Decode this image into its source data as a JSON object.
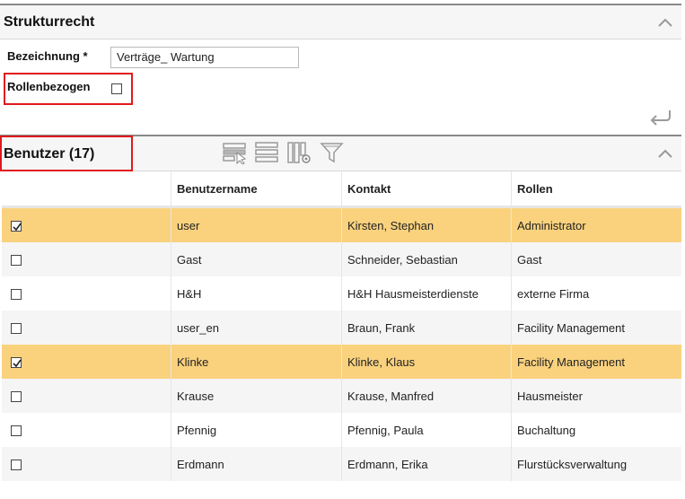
{
  "section1": {
    "title": "Strukturrecht"
  },
  "form": {
    "bezeichnung_label": "Bezeichnung *",
    "bezeichnung_value": "Verträge_ Wartung",
    "rollenbezogen_label": "Rollenbezogen",
    "rollenbezogen_checked": false
  },
  "section2": {
    "title": "Benutzer (17)"
  },
  "toolbar_icons": [
    "select-row-icon",
    "list-view-icon",
    "column-settings-icon",
    "filter-icon"
  ],
  "colors": {
    "selected_row": "#fad27e",
    "highlight_border": "#e0191d"
  },
  "table": {
    "headers": [
      "",
      "Benutzername",
      "Kontakt",
      "Rollen"
    ],
    "rows": [
      {
        "checked": true,
        "username": "user",
        "contact": "Kirsten, Stephan",
        "role": "Administrator"
      },
      {
        "checked": false,
        "username": "Gast",
        "contact": "Schneider, Sebastian",
        "role": "Gast"
      },
      {
        "checked": false,
        "username": "H&H",
        "contact": "H&H Hausmeisterdienste",
        "role": "externe Firma"
      },
      {
        "checked": false,
        "username": "user_en",
        "contact": "Braun, Frank",
        "role": "Facility Management"
      },
      {
        "checked": true,
        "username": "Klinke",
        "contact": "Klinke, Klaus",
        "role": "Facility Management"
      },
      {
        "checked": false,
        "username": "Krause",
        "contact": "Krause, Manfred",
        "role": "Hausmeister"
      },
      {
        "checked": false,
        "username": "Pfennig",
        "contact": "Pfennig, Paula",
        "role": "Buchaltung"
      },
      {
        "checked": false,
        "username": "Erdmann",
        "contact": "Erdmann, Erika",
        "role": "Flurstücksverwaltung"
      }
    ]
  }
}
